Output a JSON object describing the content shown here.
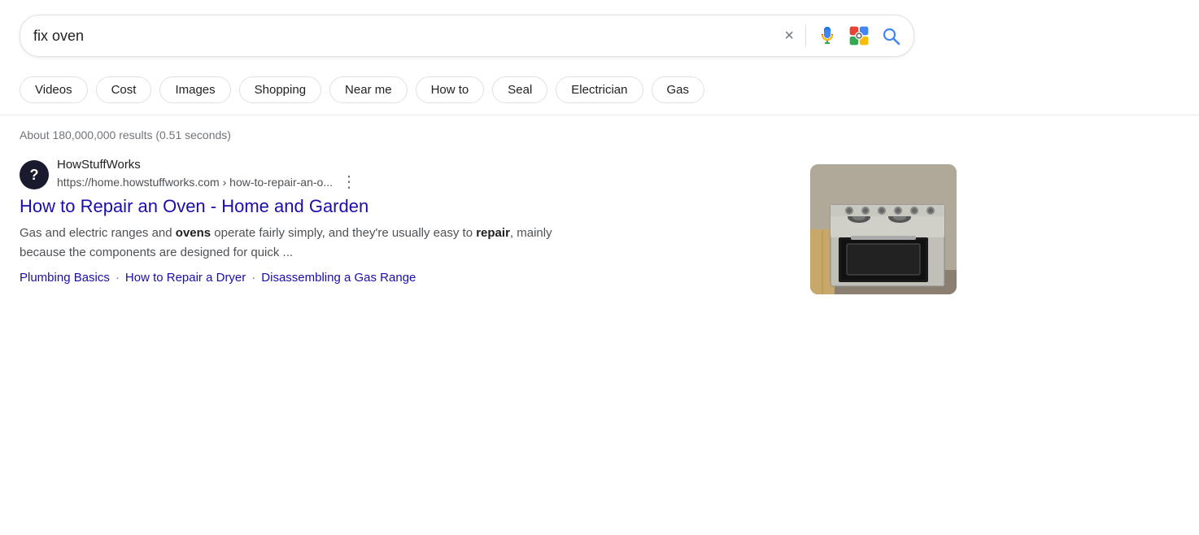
{
  "search": {
    "query": "fix oven",
    "clear_label": "×",
    "search_label": "🔍"
  },
  "chips": [
    {
      "label": "Videos",
      "id": "chip-videos"
    },
    {
      "label": "Cost",
      "id": "chip-cost"
    },
    {
      "label": "Images",
      "id": "chip-images"
    },
    {
      "label": "Shopping",
      "id": "chip-shopping"
    },
    {
      "label": "Near me",
      "id": "chip-near-me"
    },
    {
      "label": "How to",
      "id": "chip-how-to"
    },
    {
      "label": "Seal",
      "id": "chip-seal"
    },
    {
      "label": "Electrician",
      "id": "chip-electrician"
    },
    {
      "label": "Gas",
      "id": "chip-gas"
    }
  ],
  "results_meta": {
    "text": "About 180,000,000 results (0.51 seconds)"
  },
  "result": {
    "favicon_letter": "?",
    "site_name": "HowStuffWorks",
    "site_url": "https://home.howstuffworks.com › how-to-repair-an-o...",
    "title": "How to Repair an Oven - Home and Garden",
    "title_url": "#",
    "snippet_before": "Gas and electric ranges and ",
    "snippet_bold1": "ovens",
    "snippet_middle": " operate fairly simply, and they're usually easy to ",
    "snippet_bold2": "repair",
    "snippet_after": ", mainly because the components are designed for quick ...",
    "links": [
      {
        "label": "Plumbing Basics",
        "url": "#"
      },
      {
        "label": "How to Repair a Dryer",
        "url": "#"
      },
      {
        "label": "Disassembling a Gas Range",
        "url": "#"
      }
    ]
  }
}
